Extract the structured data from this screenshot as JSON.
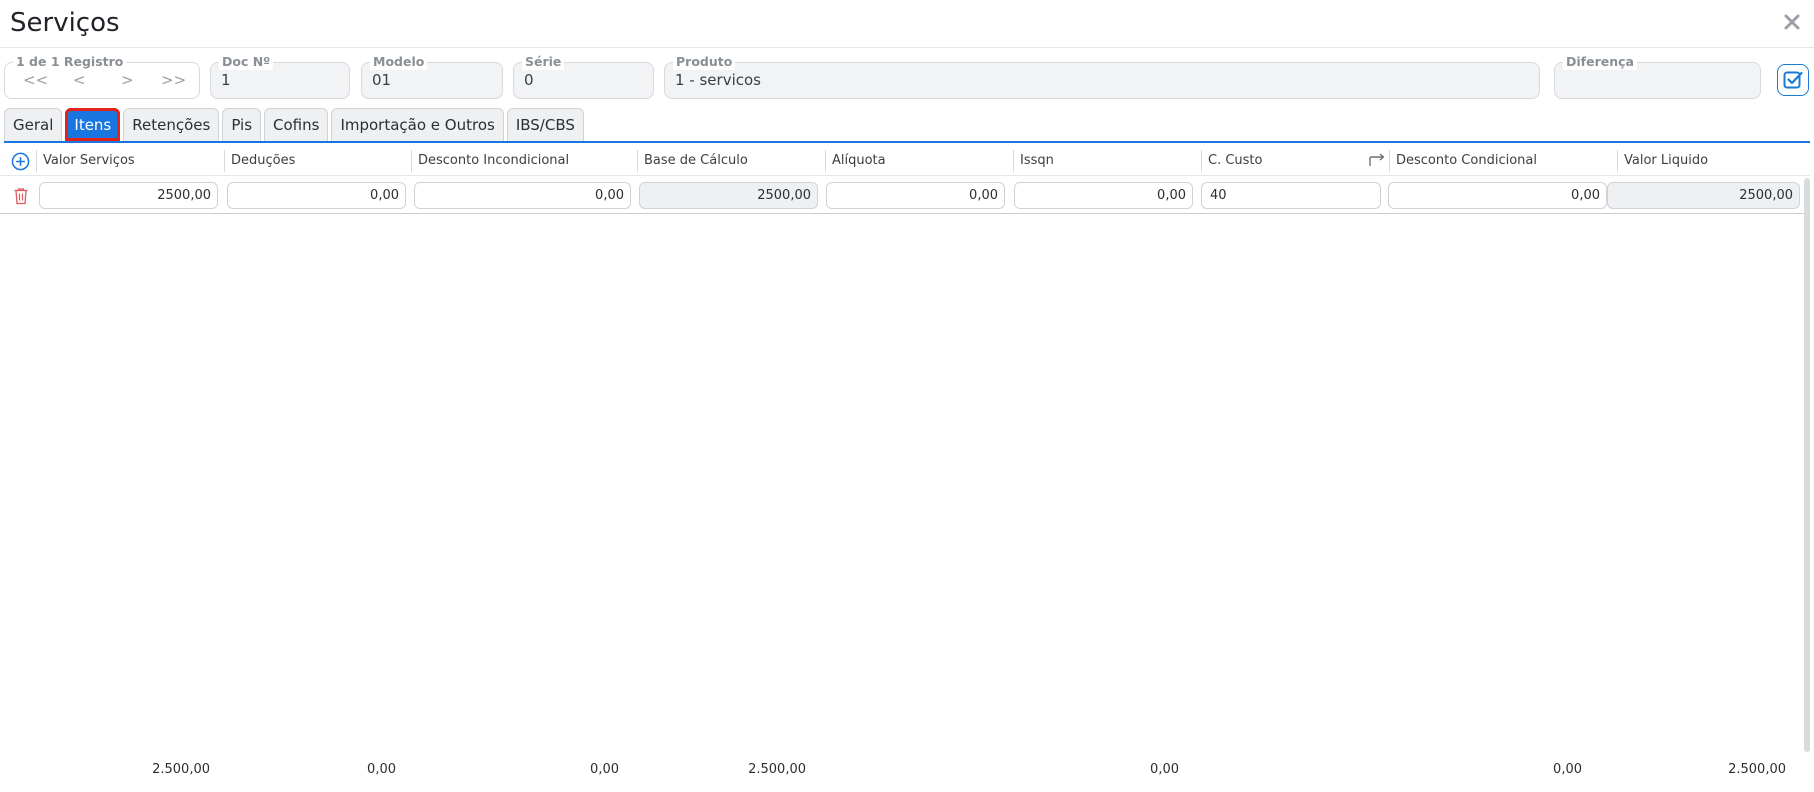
{
  "window": {
    "title": "Serviços"
  },
  "nav": {
    "label": "1 de 1 Registro",
    "first": "<<",
    "prev": "<",
    "next": ">",
    "last": ">>"
  },
  "fields": {
    "doc": {
      "label": "Doc Nº",
      "value": "1"
    },
    "modelo": {
      "label": "Modelo",
      "value": "01"
    },
    "serie": {
      "label": "Série",
      "value": "0"
    },
    "produto": {
      "label": "Produto",
      "value": "1 - servicos"
    },
    "diferenca": {
      "label": "Diferença",
      "value": ""
    }
  },
  "tabs": [
    {
      "label": "Geral",
      "active": false
    },
    {
      "label": "Itens",
      "active": true
    },
    {
      "label": "Retenções",
      "active": false
    },
    {
      "label": "Pis",
      "active": false
    },
    {
      "label": "Cofins",
      "active": false
    },
    {
      "label": "Importação e Outros",
      "active": false
    },
    {
      "label": "IBS/CBS",
      "active": false
    }
  ],
  "grid": {
    "columns": [
      "Valor Serviços",
      "Deduções",
      "Desconto Incondicional",
      "Base de Cálculo",
      "Alíquota",
      "Issqn",
      "C. Custo",
      "Desconto Condicional",
      "Valor Liquido"
    ],
    "row": {
      "valor_servicos": "2500,00",
      "deducoes": "0,00",
      "desconto_incondicional": "0,00",
      "base_calculo": "2500,00",
      "aliquota": "0,00",
      "issqn": "0,00",
      "c_custo": "40",
      "desconto_condicional": "0,00",
      "valor_liquido": "2500,00"
    },
    "totals": {
      "valor_servicos": "2.500,00",
      "deducoes": "0,00",
      "desconto_incondicional": "0,00",
      "base_calculo": "2.500,00",
      "issqn": "0,00",
      "desconto_condicional": "0,00",
      "valor_liquido": "2.500,00"
    }
  },
  "icons": {
    "close": "close-icon",
    "confirm": "checkbox-check-icon",
    "add": "plus-circle-icon",
    "delete": "trash-icon",
    "cost_center_link": "arrow-forward-icon"
  },
  "colors": {
    "accent": "#1976e0",
    "highlight": "#e2231a",
    "danger": "#e05a5a"
  }
}
